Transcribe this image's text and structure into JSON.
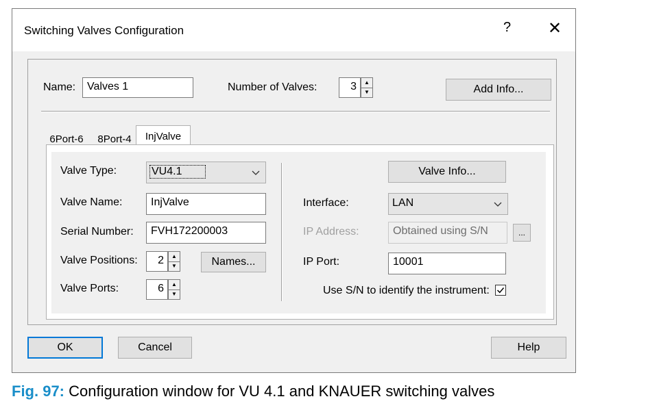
{
  "window": {
    "title": "Switching Valves Configuration",
    "help_glyph": "?",
    "close_glyph": "✕"
  },
  "top": {
    "name_label": "Name:",
    "name_value": "Valves 1",
    "num_valves_label": "Number of Valves:",
    "num_valves_value": "3",
    "add_info_label": "Add Info..."
  },
  "tabs": [
    {
      "label": "6Port-6",
      "active": false
    },
    {
      "label": "8Port-4",
      "active": false
    },
    {
      "label": "InjValve",
      "active": true
    }
  ],
  "valve": {
    "type_label": "Valve Type:",
    "type_value": "VU4.1",
    "name_label": "Valve Name:",
    "name_value": "InjValve",
    "serial_label": "Serial Number:",
    "serial_value": "FVH172200003",
    "positions_label": "Valve Positions:",
    "positions_value": "2",
    "names_button": "Names...",
    "ports_label": "Valve Ports:",
    "ports_value": "6"
  },
  "connection": {
    "valve_info_button": "Valve Info...",
    "interface_label": "Interface:",
    "interface_value": "LAN",
    "ip_address_label": "IP Address:",
    "ip_address_value": "Obtained using S/N",
    "browse_button": "...",
    "ip_port_label": "IP Port:",
    "ip_port_value": "10001",
    "use_sn_label": "Use S/N to identify the instrument:",
    "use_sn_checked": true
  },
  "footer": {
    "ok": "OK",
    "cancel": "Cancel",
    "help": "Help"
  },
  "caption": {
    "fig": "Fig. 97:",
    "text": "Configuration window for VU 4.1 and KNAUER switching valves"
  }
}
